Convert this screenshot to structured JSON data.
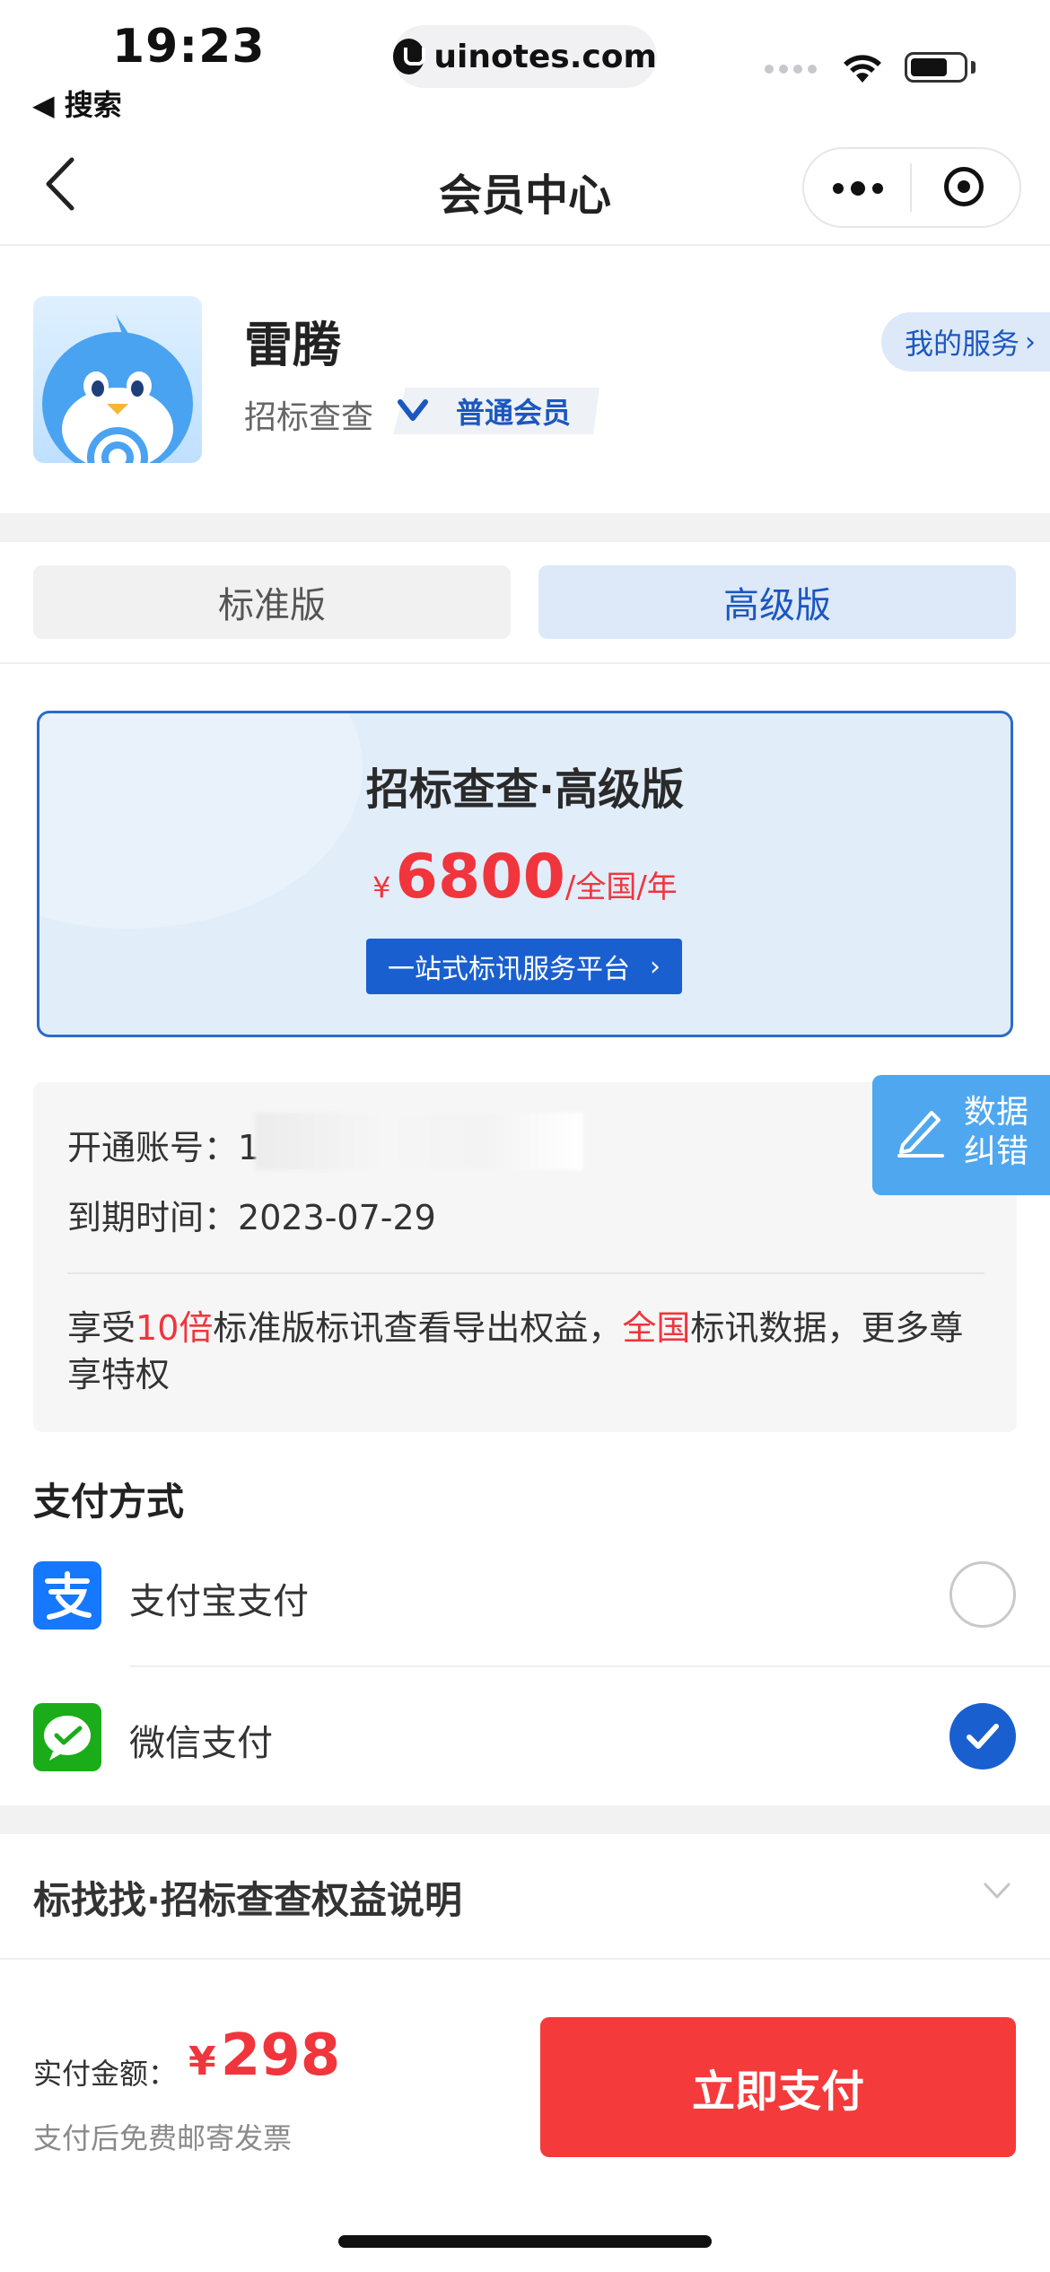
{
  "status_bar": {
    "time": "19:23",
    "back_app": "◀ 搜索",
    "url": "uinotes.com"
  },
  "nav": {
    "title": "会员中心"
  },
  "profile": {
    "name": "雷腾",
    "app_name": "招标查查",
    "member_level": "普通会员",
    "my_service": "我的服务"
  },
  "tabs": [
    {
      "label": "标准版",
      "active": false
    },
    {
      "label": "高级版",
      "active": true
    }
  ],
  "plan": {
    "title": "招标查查·高级版",
    "currency": "¥",
    "price": "6800",
    "unit": "/全国/年",
    "button": "一站式标讯服务平台"
  },
  "account": {
    "account_label": "开通账号：",
    "account_value": "1",
    "expiry_label": "到期时间：",
    "expiry_value": "2023-07-29",
    "benefit_part1": "享受",
    "benefit_highlight1": "10倍",
    "benefit_part2": "标准版标讯查看导出权益，",
    "benefit_highlight2": "全国",
    "benefit_part3": "标讯数据，更多尊享特权"
  },
  "correction": {
    "line1": "数据",
    "line2": "纠错"
  },
  "payment": {
    "heading": "支付方式",
    "methods": [
      {
        "label": "支付宝支付",
        "selected": false,
        "icon": "alipay-icon"
      },
      {
        "label": "微信支付",
        "selected": true,
        "icon": "wechat-pay-icon"
      }
    ]
  },
  "rights": {
    "title": "标找找·招标查查权益说明"
  },
  "footer": {
    "amount_label": "实付金额：",
    "currency": "¥",
    "amount": "298",
    "note": "支付后免费邮寄发票",
    "pay_button": "立即支付"
  },
  "colors": {
    "primary_blue": "#1a5fcf",
    "price_red": "#f0353d",
    "pay_button_red": "#f53a3b"
  }
}
